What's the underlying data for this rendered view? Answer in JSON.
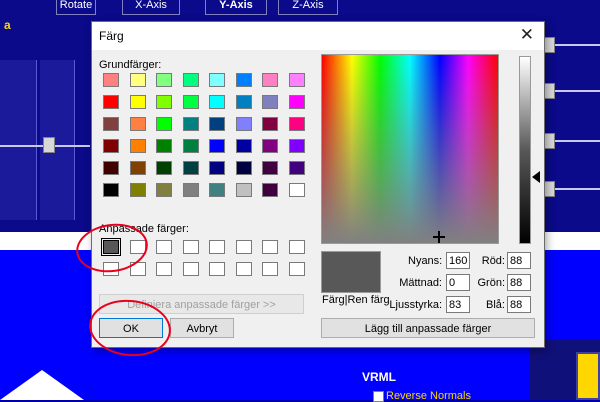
{
  "background": {
    "toolbar_buttons": [
      "Rotate",
      "X-Axis",
      "Y-Axis",
      "Z-Axis"
    ],
    "partial_label": "a",
    "vrml_heading": "VRML",
    "reverse_normals_label": "Reverse Normals"
  },
  "dialog": {
    "title": "Färg",
    "close_glyph": "✕",
    "basic_colors_label": "Grundfärger:",
    "basic_colors": [
      "#ff8080",
      "#ffff80",
      "#80ff80",
      "#00ff80",
      "#80ffff",
      "#0080ff",
      "#ff80c0",
      "#ff80ff",
      "#ff0000",
      "#ffff00",
      "#80ff00",
      "#00ff40",
      "#00ffff",
      "#0080c0",
      "#8080c0",
      "#ff00ff",
      "#804040",
      "#ff8040",
      "#00ff00",
      "#008080",
      "#004080",
      "#8080ff",
      "#800040",
      "#ff0080",
      "#800000",
      "#ff8000",
      "#008000",
      "#008040",
      "#0000ff",
      "#0000a0",
      "#800080",
      "#8000ff",
      "#400000",
      "#804000",
      "#004000",
      "#004040",
      "#000080",
      "#000040",
      "#400040",
      "#400080",
      "#000000",
      "#808000",
      "#808040",
      "#808080",
      "#408080",
      "#c0c0c0",
      "#400040",
      "#ffffff"
    ],
    "custom_colors_label": "Anpassade färger:",
    "custom_colors": [
      "#585858"
    ],
    "define_custom_button": "Definiera anpassade färger >>",
    "ok_button": "OK",
    "cancel_button": "Avbryt",
    "preview_label": "Färg|Ren färg",
    "fields": {
      "hue_label": "Nyans:",
      "hue_value": "160",
      "sat_label": "Mättnad:",
      "sat_value": "0",
      "lum_label": "Ljusstyrka:",
      "lum_value": "83",
      "red_label": "Röd:",
      "red_value": "88",
      "green_label": "Grön:",
      "green_value": "88",
      "blue_label": "Blå:",
      "blue_value": "88"
    },
    "add_custom_button": "Lägg till anpassade färger",
    "preview_color": "#585858"
  },
  "annotation_color": "#e8001c"
}
